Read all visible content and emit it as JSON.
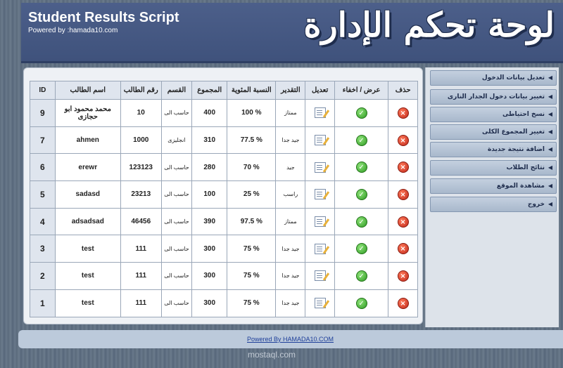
{
  "header": {
    "title": "Student Results Script",
    "subtitle": "Powered by :hamada10.com",
    "logo_text": "لوحة تحكم الإدارة"
  },
  "table": {
    "columns": [
      "ID",
      "اسم الطالب",
      "رقم الطالب",
      "القسم",
      "المجموع",
      "النسبة المئوية",
      "التقدير",
      "تعديل",
      "عرض / اخفاء",
      "حذف"
    ],
    "rows": [
      {
        "id": "9",
        "name": "محمد محمود ابو حجازى",
        "number": "10",
        "department": "حاسب الى",
        "total": "400",
        "percentage": "100 %",
        "grade": "ممتاز"
      },
      {
        "id": "7",
        "name": "ahmen",
        "number": "1000",
        "department": "انجليزى",
        "total": "310",
        "percentage": "77.5 %",
        "grade": "جيد جدا"
      },
      {
        "id": "6",
        "name": "erewr",
        "number": "123123",
        "department": "حاسب الى",
        "total": "280",
        "percentage": "70 %",
        "grade": "جيد"
      },
      {
        "id": "5",
        "name": "sadasd",
        "number": "23213",
        "department": "حاسب الى",
        "total": "100",
        "percentage": "25 %",
        "grade": "راسب"
      },
      {
        "id": "4",
        "name": "adsadsad",
        "number": "46456",
        "department": "حاسب الى",
        "total": "390",
        "percentage": "97.5 %",
        "grade": "ممتاز"
      },
      {
        "id": "3",
        "name": "test",
        "number": "111",
        "department": "حاسب الى",
        "total": "300",
        "percentage": "75 %",
        "grade": "جيد جدا"
      },
      {
        "id": "2",
        "name": "test",
        "number": "111",
        "department": "حاسب الى",
        "total": "300",
        "percentage": "75 %",
        "grade": "جيد جدا"
      },
      {
        "id": "1",
        "name": "test",
        "number": "111",
        "department": "حاسب الى",
        "total": "300",
        "percentage": "75 %",
        "grade": "جيد جدا"
      }
    ]
  },
  "sidebar": {
    "items": [
      {
        "label": "تعديل بيانات الدخول"
      },
      {
        "label": "تغيير بيانات دخول الجدار النارى"
      },
      {
        "label": "نسخ احتياطى"
      },
      {
        "label": "تغيير المجموع الكلى"
      },
      {
        "label": "اضافة نتيجة جديدة"
      },
      {
        "label": "نتائج الطلاب"
      },
      {
        "label": "مشاهدة الموقع"
      },
      {
        "label": "خروج"
      }
    ]
  },
  "footer": {
    "link_text": "Powered By HAMADA10.COM"
  },
  "watermark": "mostaql.com",
  "icons": {
    "edit": "edit-icon",
    "show_hide": "check-icon",
    "delete": "delete-icon",
    "menu_arrow": "triangle-left-icon"
  },
  "colors": {
    "header_bg": "#3f527c",
    "table_header_bg": "#dfe5ee",
    "menu_bg": "#b4c3d6",
    "delete": "#c0281a",
    "check": "#2e9a22",
    "link": "#1e3f9a"
  }
}
